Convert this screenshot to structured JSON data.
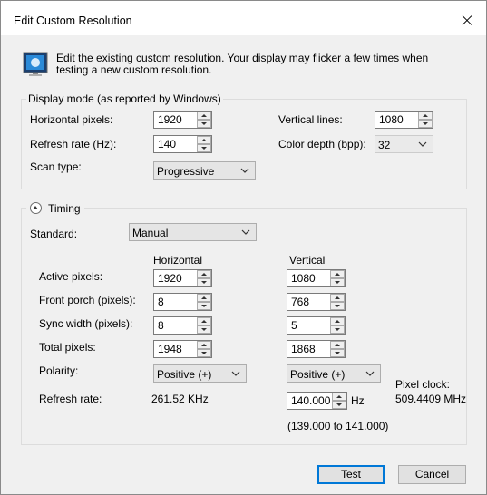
{
  "window": {
    "title": "Edit Custom Resolution"
  },
  "intro": {
    "text": "Edit the existing custom resolution. Your display may flicker a few times when testing a new custom resolution."
  },
  "display_mode": {
    "legend": "Display mode (as reported by Windows)",
    "horizontal_pixels": {
      "label": "Horizontal pixels:",
      "value": "1920"
    },
    "vertical_lines": {
      "label": "Vertical lines:",
      "value": "1080"
    },
    "refresh_rate": {
      "label": "Refresh rate (Hz):",
      "value": "140"
    },
    "color_depth": {
      "label": "Color depth (bpp):",
      "value": "32"
    },
    "scan_type": {
      "label": "Scan type:",
      "value": "Progressive"
    }
  },
  "timing": {
    "legend": "Timing",
    "standard": {
      "label": "Standard:",
      "value": "Manual"
    },
    "col_horizontal": "Horizontal",
    "col_vertical": "Vertical",
    "active_pixels": {
      "label": "Active pixels:",
      "h": "1920",
      "v": "1080"
    },
    "front_porch": {
      "label": "Front porch (pixels):",
      "h": "8",
      "v": "768"
    },
    "sync_width": {
      "label": "Sync width (pixels):",
      "h": "8",
      "v": "5"
    },
    "total_pixels": {
      "label": "Total pixels:",
      "h": "1948",
      "v": "1868"
    },
    "polarity": {
      "label": "Polarity:",
      "h": "Positive (+)",
      "v": "Positive (+)"
    },
    "refresh_rate": {
      "label": "Refresh rate:",
      "h": "261.52 KHz",
      "v": "140.000",
      "unit": "Hz",
      "range": "(139.000 to 141.000)"
    },
    "pixel_clock": {
      "label": "Pixel clock:",
      "value": "509.4409 MHz"
    }
  },
  "buttons": {
    "test": "Test",
    "cancel": "Cancel"
  },
  "colors": {
    "accent": "#0078d7",
    "dialog_bg": "#f0f0f0",
    "titlebar_bg": "#ffffff"
  }
}
